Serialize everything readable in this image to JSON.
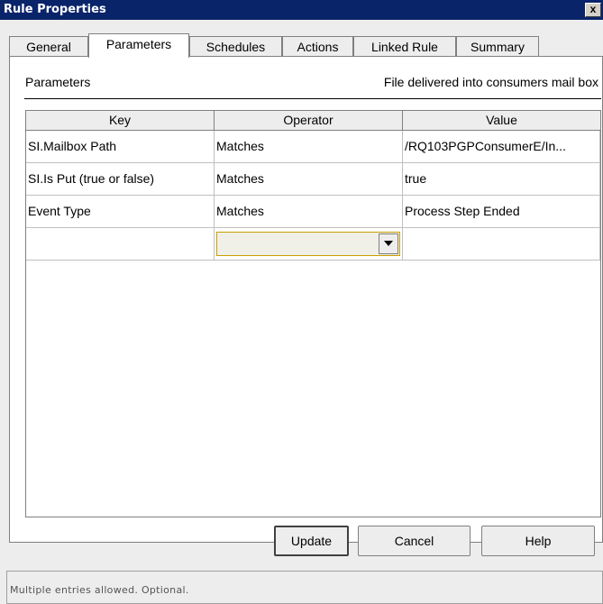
{
  "window": {
    "title": "Rule Properties",
    "close_label": "x"
  },
  "tabs": [
    {
      "label": "General",
      "active": false
    },
    {
      "label": "Parameters",
      "active": true
    },
    {
      "label": "Schedules",
      "active": false
    },
    {
      "label": "Actions",
      "active": false
    },
    {
      "label": "Linked Rule",
      "active": false
    },
    {
      "label": "Summary",
      "active": false
    }
  ],
  "section": {
    "title": "Parameters",
    "description": "File delivered into consumers mail box"
  },
  "table": {
    "columns": [
      "Key",
      "Operator",
      "Value"
    ],
    "rows": [
      {
        "key": "SI.Mailbox Path",
        "operator": "Matches",
        "value": "/RQ103PGPConsumerE/In..."
      },
      {
        "key": "SI.Is Put (true or false)",
        "operator": "Matches",
        "value": "true"
      },
      {
        "key": "Event Type",
        "operator": "Matches",
        "value": "Process Step Ended"
      }
    ],
    "new_row_operator": ""
  },
  "buttons": {
    "update": "Update",
    "cancel": "Cancel",
    "help": "Help"
  },
  "status": {
    "text": "Multiple entries allowed. Optional."
  },
  "colors": {
    "titlebar": "#0a246a",
    "dialog_bg": "#ededed",
    "dropdown_border": "#c8a000"
  },
  "icons": {
    "close": "close-icon",
    "dropdown": "chevron-down-icon"
  }
}
